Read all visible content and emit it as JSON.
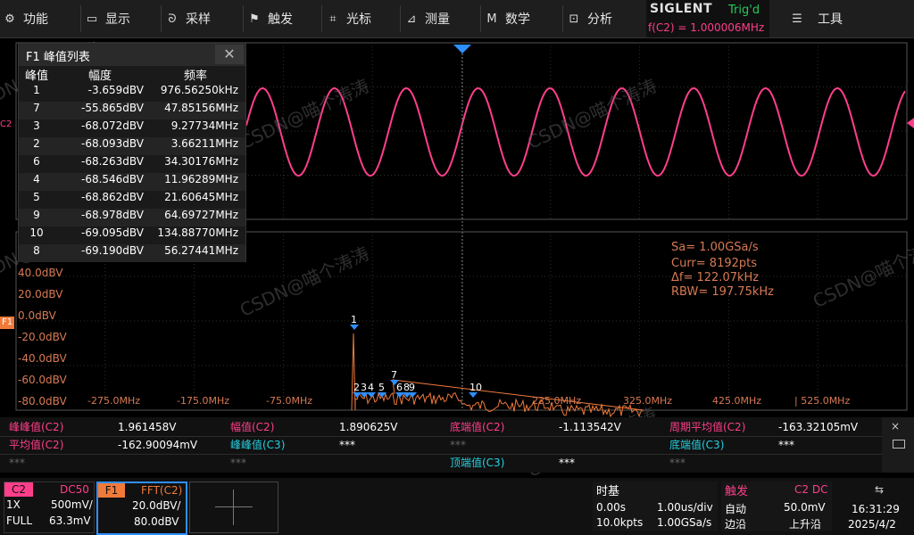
{
  "menu": [
    {
      "label": "功能",
      "icon": "gear-icon",
      "glyph": "⚙"
    },
    {
      "label": "显示",
      "icon": "monitor-icon",
      "glyph": "▭"
    },
    {
      "label": "采样",
      "icon": "sampling-icon",
      "glyph": "ᘐ"
    },
    {
      "label": "触发",
      "icon": "flag-icon",
      "glyph": "⚑"
    },
    {
      "label": "光标",
      "icon": "cursor-icon",
      "glyph": "⌗"
    },
    {
      "label": "测量",
      "icon": "measure-icon",
      "glyph": "⊿"
    },
    {
      "label": "数学",
      "icon": "math-icon",
      "glyph": "M"
    },
    {
      "label": "分析",
      "icon": "analysis-icon",
      "glyph": "⊡"
    }
  ],
  "brand": {
    "name": "SIGLENT",
    "trig_state": "Trig'd",
    "freq": "f(C2) = 1.000006MHz"
  },
  "tools": {
    "label": "工具",
    "icon": "list-icon"
  },
  "peak_table": {
    "title": "F1 峰值列表",
    "close": "✕",
    "headers": [
      "峰值",
      "幅度",
      "频率"
    ],
    "rows": [
      [
        "1",
        "-3.659dBV",
        "976.56250kHz"
      ],
      [
        "7",
        "-55.865dBV",
        "47.85156MHz"
      ],
      [
        "3",
        "-68.072dBV",
        "9.27734MHz"
      ],
      [
        "2",
        "-68.093dBV",
        "3.66211MHz"
      ],
      [
        "6",
        "-68.263dBV",
        "34.30176MHz"
      ],
      [
        "4",
        "-68.546dBV",
        "11.96289MHz"
      ],
      [
        "5",
        "-68.862dBV",
        "21.60645MHz"
      ],
      [
        "9",
        "-68.978dBV",
        "64.69727MHz"
      ],
      [
        "10",
        "-69.095dBV",
        "134.88770MHz"
      ],
      [
        "8",
        "-69.190dBV",
        "56.27441MHz"
      ]
    ]
  },
  "fft_info": {
    "sa": "Sa= 1.00GSa/s",
    "curr": "Curr= 8192pts",
    "df": "Δf= 122.07kHz",
    "rbw": "RBW= 197.75kHz"
  },
  "y_labels": [
    "40.0dBV",
    "20.0dBV",
    "0.0dBV",
    "-20.0dBV",
    "-40.0dBV",
    "-60.0dBV",
    "-80.0dBV"
  ],
  "x_labels": [
    "-275.0MHz",
    "-175.0MHz",
    "-75.0MHz",
    "225.0MHz",
    "325.0MHz",
    "425.0MHz",
    "| 525.0MHz"
  ],
  "channel_markers": {
    "c2": "C2",
    "f1": "F1"
  },
  "peak_markers": [
    "1",
    "7",
    "2",
    "3",
    "4",
    "5",
    "6",
    "8",
    "9",
    "10"
  ],
  "measurements": [
    [
      {
        "label": "峰峰值(C2)",
        "value": "1.961458V",
        "color": "pink"
      },
      {
        "label": "幅值(C2)",
        "value": "1.890625V",
        "color": "pink"
      },
      {
        "label": "底端值(C2)",
        "value": "-1.113542V",
        "color": "pink"
      },
      {
        "label": "周期平均值(C2)",
        "value": "-163.32105mV",
        "color": "pink"
      }
    ],
    [
      {
        "label": "平均值(C2)",
        "value": "-162.90094mV",
        "color": "pink"
      },
      {
        "label": "峰峰值(C3)",
        "value": "***",
        "color": "cyan"
      },
      {
        "label": "***",
        "value": "",
        "color": "gray"
      },
      {
        "label": "底端值(C3)",
        "value": "***",
        "color": "cyan"
      }
    ],
    [
      {
        "label": "***",
        "value": "",
        "color": "gray"
      },
      {
        "label": "***",
        "value": "",
        "color": "gray"
      },
      {
        "label": "顶端值(C3)",
        "value": "***",
        "color": "cyan"
      },
      {
        "label": "***",
        "value": "",
        "color": "gray"
      }
    ]
  ],
  "c2_box": {
    "name": "C2",
    "coupling": "DC50",
    "probe": "1X",
    "scale": "500mV/",
    "bw": "FULL",
    "offset": "63.3mV"
  },
  "f1_box": {
    "name": "F1",
    "mode": "FFT(C2)",
    "scale": "20.0dBV/",
    "ref": "80.0dBV"
  },
  "timebase": {
    "title": "时基",
    "delay": "0.00s",
    "scale": "1.00us/div",
    "pts": "10.0kpts",
    "rate": "1.00GSa/s"
  },
  "trigger": {
    "title": "触发",
    "source": "C2 DC",
    "mode": "自动",
    "level": "50.0mV",
    "type": "边沿",
    "slope": "上升沿"
  },
  "system": {
    "time": "16:31:29",
    "date": "2025/4/2",
    "usb": "⇆"
  },
  "watermarks": [
    "CSDN@喵个涛涛",
    "CSDN@喵个涛涛",
    "CSDN@喵个涛涛",
    "CSDN@喵个涛涛",
    "CSDN@喵个涛涛",
    "CSDN@喵个涛涛",
    "CSDN@喵个涛涛"
  ],
  "colors": {
    "c2": "#ff3f8a",
    "f1": "#f07a3a",
    "grid": "#3a3a3a",
    "accent": "#2f8fff"
  }
}
